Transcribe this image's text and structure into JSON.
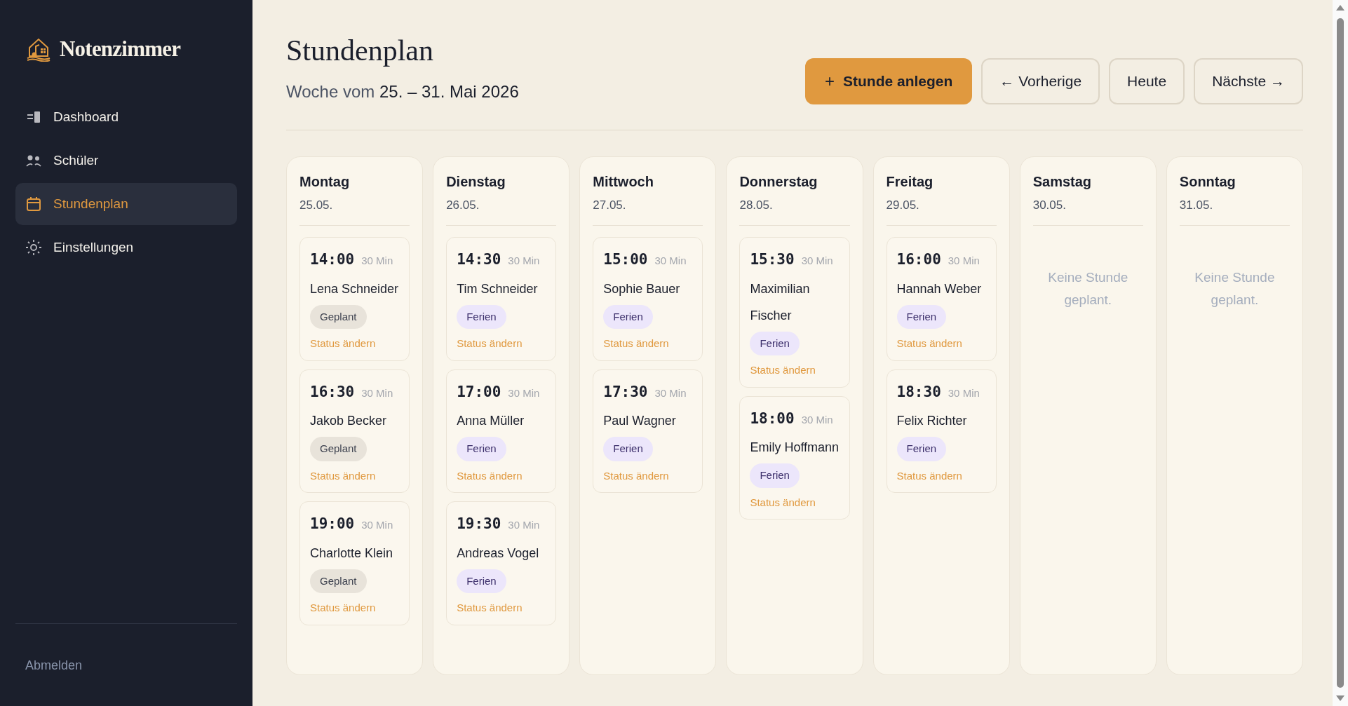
{
  "sidebar": {
    "brand": "Notenzimmer",
    "items": [
      {
        "label": "Dashboard",
        "kind": "dashboard",
        "selected": false
      },
      {
        "label": "Schüler",
        "kind": "students",
        "selected": false
      },
      {
        "label": "Stundenplan",
        "kind": "schedule",
        "selected": true
      },
      {
        "label": "Einstellungen",
        "kind": "settings",
        "selected": false
      }
    ],
    "logout": "Abmelden"
  },
  "header": {
    "title": "Stundenplan",
    "week_prefix": "Woche vom",
    "week_range": "25. – 31. Mai 2026",
    "buttons": [
      {
        "label": "Stunde anlegen",
        "icon": "+",
        "kind": "primary"
      },
      {
        "label": "← Vorherige",
        "kind": "secondary"
      },
      {
        "label": "Heute",
        "kind": "secondary"
      },
      {
        "label": "Nächste →",
        "kind": "secondary"
      }
    ]
  },
  "days": [
    {
      "name": "Montag",
      "date": "25.05.",
      "lessons": [
        {
          "time": "14:00",
          "duration": "30 Min",
          "student": "Lena Schneider",
          "status": {
            "label": "Geplant",
            "kind": "planned"
          },
          "action": "Status ändern"
        },
        {
          "time": "16:30",
          "duration": "30 Min",
          "student": "Jakob Becker",
          "status": {
            "label": "Geplant",
            "kind": "planned"
          },
          "action": "Status ändern"
        },
        {
          "time": "19:00",
          "duration": "30 Min",
          "student": "Charlotte Klein",
          "status": {
            "label": "Geplant",
            "kind": "planned"
          },
          "action": "Status ändern"
        }
      ]
    },
    {
      "name": "Dienstag",
      "date": "26.05.",
      "lessons": [
        {
          "time": "14:30",
          "duration": "30 Min",
          "student": "Tim Schneider",
          "status": {
            "label": "Ferien",
            "kind": "holiday"
          },
          "action": "Status ändern"
        },
        {
          "time": "17:00",
          "duration": "30 Min",
          "student": "Anna Müller",
          "status": {
            "label": "Ferien",
            "kind": "holiday"
          },
          "action": "Status ändern"
        },
        {
          "time": "19:30",
          "duration": "30 Min",
          "student": "Andreas Vogel",
          "status": {
            "label": "Ferien",
            "kind": "holiday"
          },
          "action": "Status ändern"
        }
      ]
    },
    {
      "name": "Mittwoch",
      "date": "27.05.",
      "lessons": [
        {
          "time": "15:00",
          "duration": "30 Min",
          "student": "Sophie Bauer",
          "status": {
            "label": "Ferien",
            "kind": "holiday"
          },
          "action": "Status ändern"
        },
        {
          "time": "17:30",
          "duration": "30 Min",
          "student": "Paul Wagner",
          "status": {
            "label": "Ferien",
            "kind": "holiday"
          },
          "action": "Status ändern"
        }
      ]
    },
    {
      "name": "Donnerstag",
      "date": "28.05.",
      "lessons": [
        {
          "time": "15:30",
          "duration": "30 Min",
          "student": "Maximilian Fischer",
          "status": {
            "label": "Ferien",
            "kind": "holiday"
          },
          "action": "Status ändern"
        },
        {
          "time": "18:00",
          "duration": "30 Min",
          "student": "Emily Hoffmann",
          "status": {
            "label": "Ferien",
            "kind": "holiday"
          },
          "action": "Status ändern"
        }
      ]
    },
    {
      "name": "Freitag",
      "date": "29.05.",
      "lessons": [
        {
          "time": "16:00",
          "duration": "30 Min",
          "student": "Hannah Weber",
          "status": {
            "label": "Ferien",
            "kind": "holiday"
          },
          "action": "Status ändern"
        },
        {
          "time": "18:30",
          "duration": "30 Min",
          "student": "Felix Richter",
          "status": {
            "label": "Ferien",
            "kind": "holiday"
          },
          "action": "Status ändern"
        }
      ]
    },
    {
      "name": "Samstag",
      "date": "30.05.",
      "empty": "Keine Stunde geplant."
    },
    {
      "name": "Sonntag",
      "date": "31.05.",
      "empty": "Keine Stunde geplant."
    }
  ]
}
